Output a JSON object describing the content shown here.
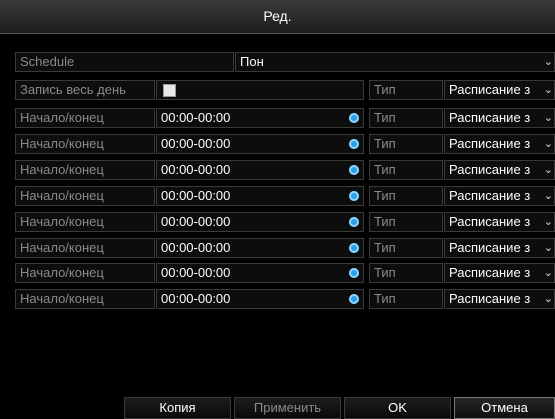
{
  "window": {
    "title": "Ред."
  },
  "schedule": {
    "label": "Schedule",
    "day": "Пон"
  },
  "allday": {
    "label": "Запись весь день",
    "type_label": "Тип",
    "type_value": "Расписание з"
  },
  "rows": [
    {
      "label": "Начало/конец",
      "time": "00:00-00:00",
      "type_label": "Тип",
      "type_value": "Расписание з"
    },
    {
      "label": "Начало/конец",
      "time": "00:00-00:00",
      "type_label": "Тип",
      "type_value": "Расписание з"
    },
    {
      "label": "Начало/конец",
      "time": "00:00-00:00",
      "type_label": "Тип",
      "type_value": "Расписание з"
    },
    {
      "label": "Начало/конец",
      "time": "00:00-00:00",
      "type_label": "Тип",
      "type_value": "Расписание з"
    },
    {
      "label": "Начало/конец",
      "time": "00:00-00:00",
      "type_label": "Тип",
      "type_value": "Расписание з"
    },
    {
      "label": "Начало/конец",
      "time": "00:00-00:00",
      "type_label": "Тип",
      "type_value": "Расписание з"
    },
    {
      "label": "Начало/конец",
      "time": "00:00-00:00",
      "type_label": "Тип",
      "type_value": "Расписание з"
    },
    {
      "label": "Начало/конец",
      "time": "00:00-00:00",
      "type_label": "Тип",
      "type_value": "Расписание з"
    }
  ],
  "buttons": {
    "copy": "Копия",
    "apply": "Применить",
    "ok": "OK",
    "cancel": "Отмена"
  },
  "icons": {
    "clock": "clock-icon",
    "chevron": "chevron-down-icon",
    "checkbox": "checkbox"
  }
}
